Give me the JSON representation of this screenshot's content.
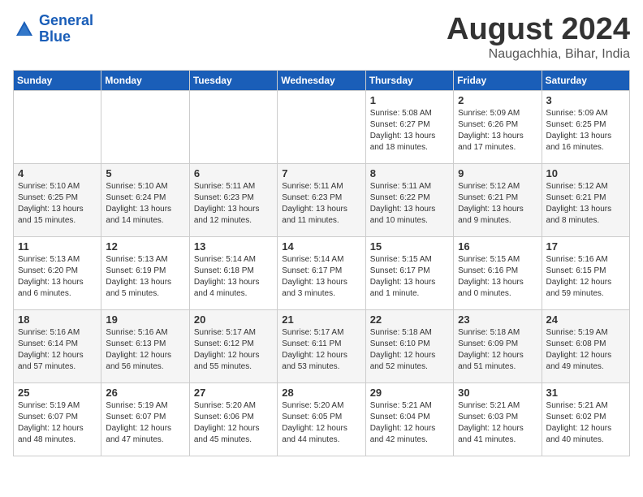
{
  "logo": {
    "line1": "General",
    "line2": "Blue"
  },
  "title": "August 2024",
  "location": "Naugachhia, Bihar, India",
  "days_of_week": [
    "Sunday",
    "Monday",
    "Tuesday",
    "Wednesday",
    "Thursday",
    "Friday",
    "Saturday"
  ],
  "weeks": [
    [
      {
        "day": "",
        "info": ""
      },
      {
        "day": "",
        "info": ""
      },
      {
        "day": "",
        "info": ""
      },
      {
        "day": "",
        "info": ""
      },
      {
        "day": "1",
        "info": "Sunrise: 5:08 AM\nSunset: 6:27 PM\nDaylight: 13 hours\nand 18 minutes."
      },
      {
        "day": "2",
        "info": "Sunrise: 5:09 AM\nSunset: 6:26 PM\nDaylight: 13 hours\nand 17 minutes."
      },
      {
        "day": "3",
        "info": "Sunrise: 5:09 AM\nSunset: 6:25 PM\nDaylight: 13 hours\nand 16 minutes."
      }
    ],
    [
      {
        "day": "4",
        "info": "Sunrise: 5:10 AM\nSunset: 6:25 PM\nDaylight: 13 hours\nand 15 minutes."
      },
      {
        "day": "5",
        "info": "Sunrise: 5:10 AM\nSunset: 6:24 PM\nDaylight: 13 hours\nand 14 minutes."
      },
      {
        "day": "6",
        "info": "Sunrise: 5:11 AM\nSunset: 6:23 PM\nDaylight: 13 hours\nand 12 minutes."
      },
      {
        "day": "7",
        "info": "Sunrise: 5:11 AM\nSunset: 6:23 PM\nDaylight: 13 hours\nand 11 minutes."
      },
      {
        "day": "8",
        "info": "Sunrise: 5:11 AM\nSunset: 6:22 PM\nDaylight: 13 hours\nand 10 minutes."
      },
      {
        "day": "9",
        "info": "Sunrise: 5:12 AM\nSunset: 6:21 PM\nDaylight: 13 hours\nand 9 minutes."
      },
      {
        "day": "10",
        "info": "Sunrise: 5:12 AM\nSunset: 6:21 PM\nDaylight: 13 hours\nand 8 minutes."
      }
    ],
    [
      {
        "day": "11",
        "info": "Sunrise: 5:13 AM\nSunset: 6:20 PM\nDaylight: 13 hours\nand 6 minutes."
      },
      {
        "day": "12",
        "info": "Sunrise: 5:13 AM\nSunset: 6:19 PM\nDaylight: 13 hours\nand 5 minutes."
      },
      {
        "day": "13",
        "info": "Sunrise: 5:14 AM\nSunset: 6:18 PM\nDaylight: 13 hours\nand 4 minutes."
      },
      {
        "day": "14",
        "info": "Sunrise: 5:14 AM\nSunset: 6:17 PM\nDaylight: 13 hours\nand 3 minutes."
      },
      {
        "day": "15",
        "info": "Sunrise: 5:15 AM\nSunset: 6:17 PM\nDaylight: 13 hours\nand 1 minute."
      },
      {
        "day": "16",
        "info": "Sunrise: 5:15 AM\nSunset: 6:16 PM\nDaylight: 13 hours\nand 0 minutes."
      },
      {
        "day": "17",
        "info": "Sunrise: 5:16 AM\nSunset: 6:15 PM\nDaylight: 12 hours\nand 59 minutes."
      }
    ],
    [
      {
        "day": "18",
        "info": "Sunrise: 5:16 AM\nSunset: 6:14 PM\nDaylight: 12 hours\nand 57 minutes."
      },
      {
        "day": "19",
        "info": "Sunrise: 5:16 AM\nSunset: 6:13 PM\nDaylight: 12 hours\nand 56 minutes."
      },
      {
        "day": "20",
        "info": "Sunrise: 5:17 AM\nSunset: 6:12 PM\nDaylight: 12 hours\nand 55 minutes."
      },
      {
        "day": "21",
        "info": "Sunrise: 5:17 AM\nSunset: 6:11 PM\nDaylight: 12 hours\nand 53 minutes."
      },
      {
        "day": "22",
        "info": "Sunrise: 5:18 AM\nSunset: 6:10 PM\nDaylight: 12 hours\nand 52 minutes."
      },
      {
        "day": "23",
        "info": "Sunrise: 5:18 AM\nSunset: 6:09 PM\nDaylight: 12 hours\nand 51 minutes."
      },
      {
        "day": "24",
        "info": "Sunrise: 5:19 AM\nSunset: 6:08 PM\nDaylight: 12 hours\nand 49 minutes."
      }
    ],
    [
      {
        "day": "25",
        "info": "Sunrise: 5:19 AM\nSunset: 6:07 PM\nDaylight: 12 hours\nand 48 minutes."
      },
      {
        "day": "26",
        "info": "Sunrise: 5:19 AM\nSunset: 6:07 PM\nDaylight: 12 hours\nand 47 minutes."
      },
      {
        "day": "27",
        "info": "Sunrise: 5:20 AM\nSunset: 6:06 PM\nDaylight: 12 hours\nand 45 minutes."
      },
      {
        "day": "28",
        "info": "Sunrise: 5:20 AM\nSunset: 6:05 PM\nDaylight: 12 hours\nand 44 minutes."
      },
      {
        "day": "29",
        "info": "Sunrise: 5:21 AM\nSunset: 6:04 PM\nDaylight: 12 hours\nand 42 minutes."
      },
      {
        "day": "30",
        "info": "Sunrise: 5:21 AM\nSunset: 6:03 PM\nDaylight: 12 hours\nand 41 minutes."
      },
      {
        "day": "31",
        "info": "Sunrise: 5:21 AM\nSunset: 6:02 PM\nDaylight: 12 hours\nand 40 minutes."
      }
    ]
  ]
}
